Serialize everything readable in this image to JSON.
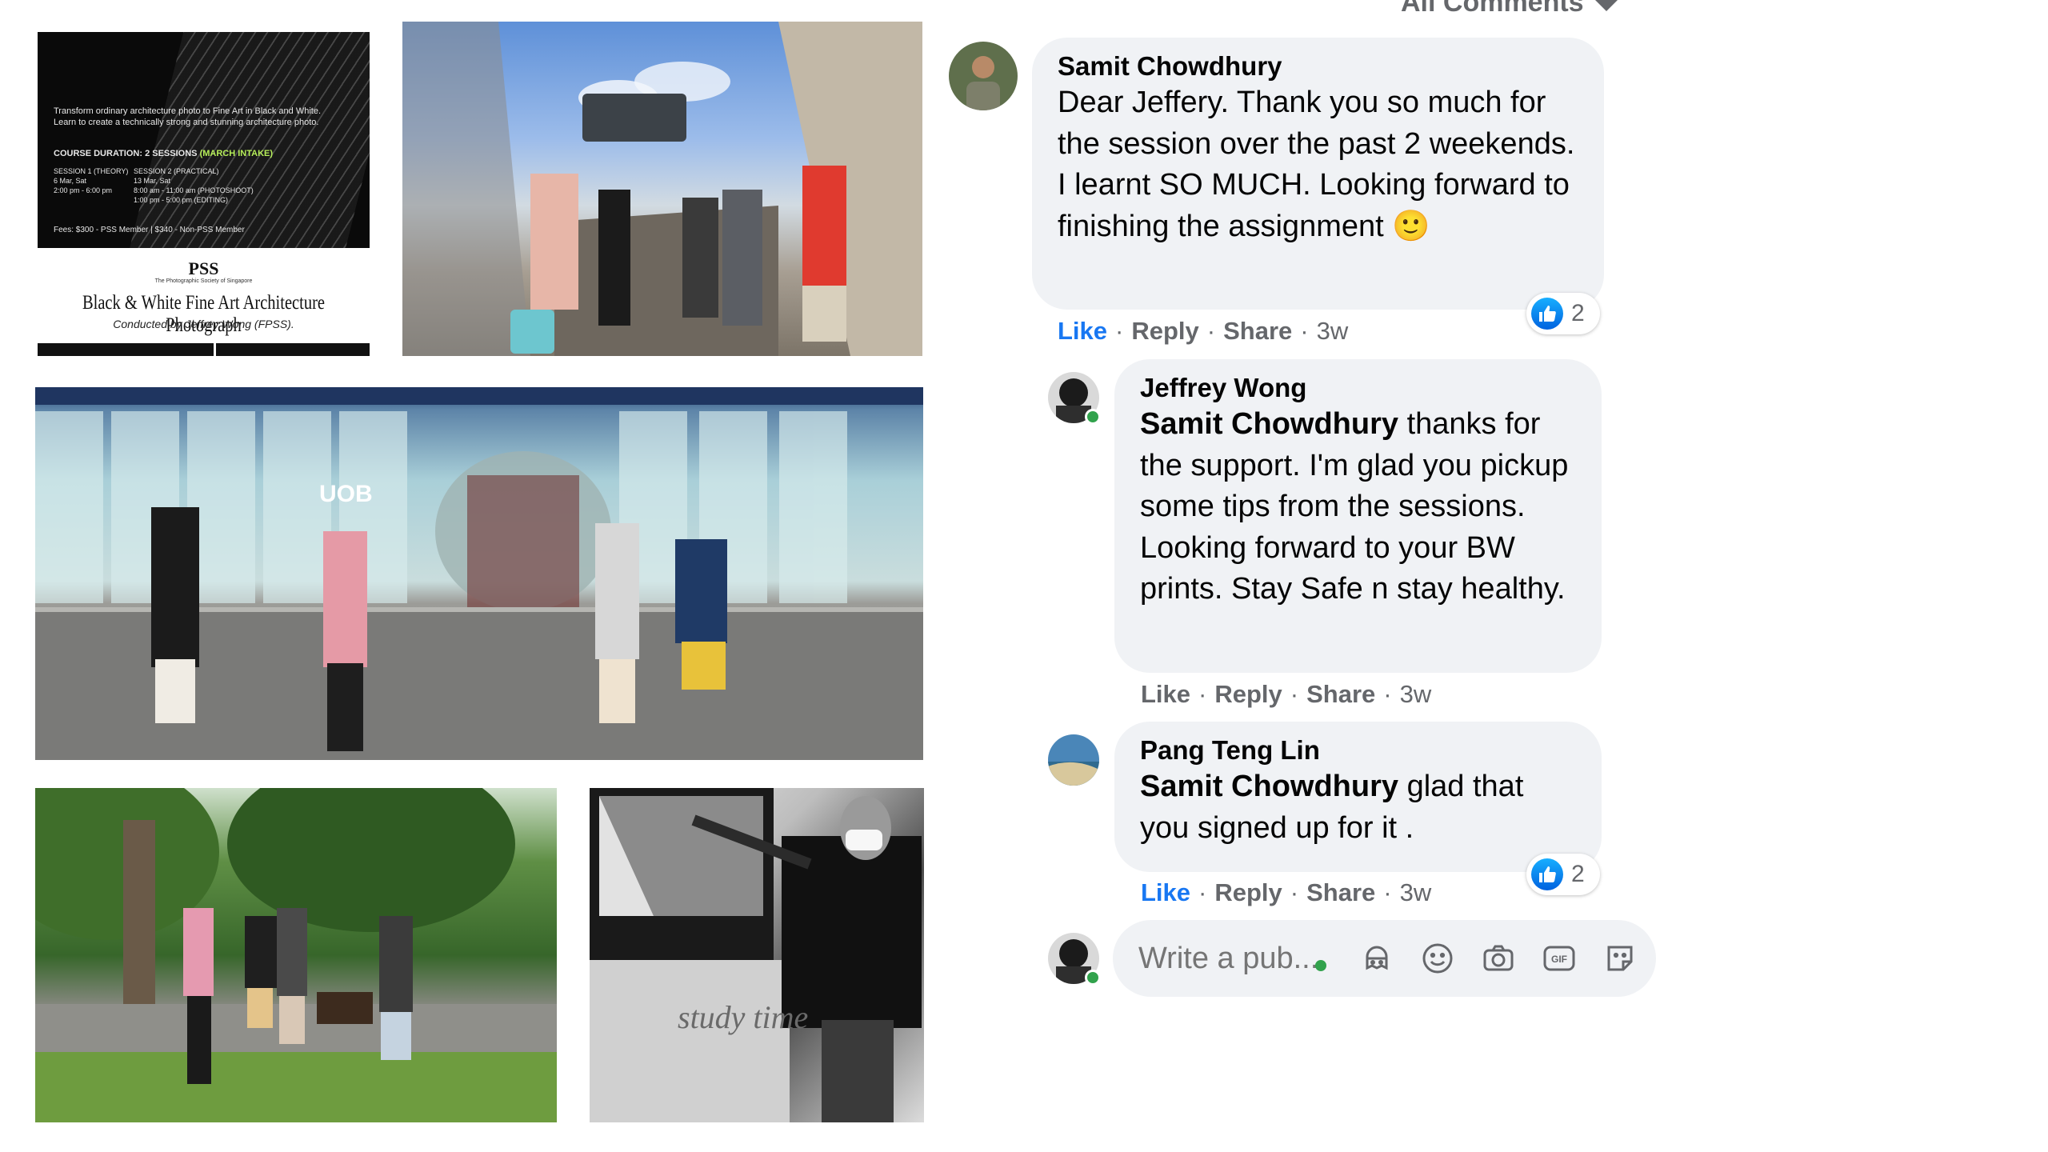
{
  "header": {
    "all_comments_label": "All Comments"
  },
  "poster": {
    "line1": "Transform ordinary architecture photo to Fine Art in Black and White.",
    "line2": "Learn to create a technically strong and stunning architecture photo.",
    "course_duration": "COURSE DURATION: 2 SESSIONS",
    "intake": "(MARCH INTAKE)",
    "session1_label": "SESSION 1 (THEORY)",
    "session1_date": "6 Mar, Sat",
    "session1_time": "2:00 pm - 6:00 pm",
    "session2_label": "SESSION 2 (PRACTICAL)",
    "session2_date": "13 Mar, Sat",
    "session2_time1": "8:00 am - 11:00 am (PHOTOSHOOT)",
    "session2_time2": "1:00 pm - 5:00 pm (EDITING)",
    "fees": "Fees: $300 - PSS Member  |  $340 - Non-PSS Member",
    "logo": "PSS",
    "logo_sub": "The Photographic Society of Singapore",
    "title": "Black & White Fine Art Architecture Photograph",
    "credit": "Conducted by Jeffrey Wong (FPSS)."
  },
  "photos": {
    "lobby_sign": "UOB",
    "bw_caption": "study time"
  },
  "comments": [
    {
      "author": "Samit Chowdhury",
      "text": "Dear Jeffery. Thank you so much for the session over the past 2 weekends. I learnt SO MUCH. Looking forward to finishing the assignment",
      "emoji": "🙂",
      "reaction_count": "2",
      "like": "Like",
      "reply": "Reply",
      "share": "Share",
      "time": "3w"
    },
    {
      "author": "Jeffrey Wong",
      "mention": "Samit Chowdhury",
      "text": "thanks for the support. I'm glad you pickup some tips from the sessions. Looking forward to your BW prints. Stay Safe n stay healthy.",
      "like": "Like",
      "reply": "Reply",
      "share": "Share",
      "time": "3w"
    },
    {
      "author": "Pang Teng Lin",
      "mention": "Samit Chowdhury",
      "text": "glad that you signed up for it .",
      "reaction_count": "2",
      "like": "Like",
      "reply": "Reply",
      "share": "Share",
      "time": "3w"
    }
  ],
  "composer": {
    "placeholder": "Write a pub...",
    "icons": [
      "avatar-sticker-icon",
      "emoji-icon",
      "camera-icon",
      "gif-icon",
      "sticker-icon"
    ]
  },
  "colors": {
    "accent": "#1877f2",
    "bubble": "#f0f2f5",
    "muted": "#65676b",
    "online": "#31a24c"
  }
}
